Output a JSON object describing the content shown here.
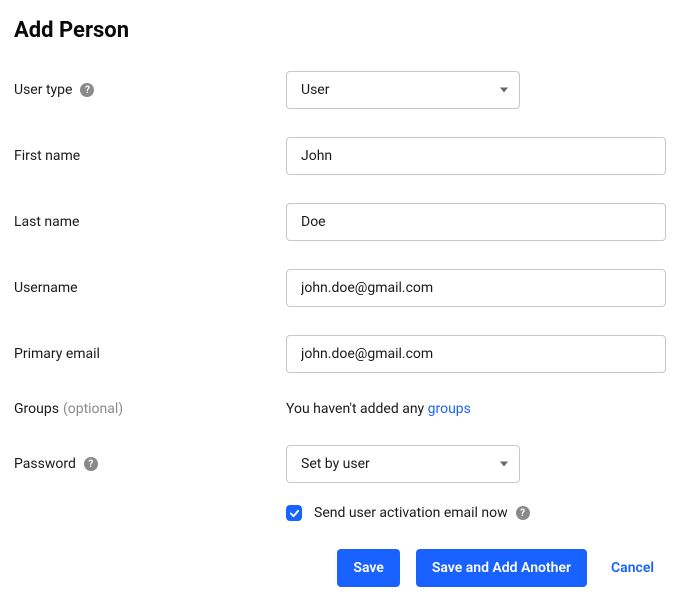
{
  "title": "Add Person",
  "fields": {
    "userType": {
      "label": "User type",
      "value": "User"
    },
    "firstName": {
      "label": "First name",
      "value": "John"
    },
    "lastName": {
      "label": "Last name",
      "value": "Doe"
    },
    "username": {
      "label": "Username",
      "value": "john.doe@gmail.com"
    },
    "primaryEmail": {
      "label": "Primary email",
      "value": "john.doe@gmail.com"
    },
    "groups": {
      "label": "Groups",
      "optional": "(optional)",
      "emptyTextPrefix": "You haven't added any ",
      "linkText": "groups"
    },
    "password": {
      "label": "Password",
      "value": "Set by user"
    },
    "activationEmail": {
      "label": "Send user activation email now",
      "checked": true
    }
  },
  "buttons": {
    "save": "Save",
    "saveAndAdd": "Save and Add Another",
    "cancel": "Cancel"
  }
}
